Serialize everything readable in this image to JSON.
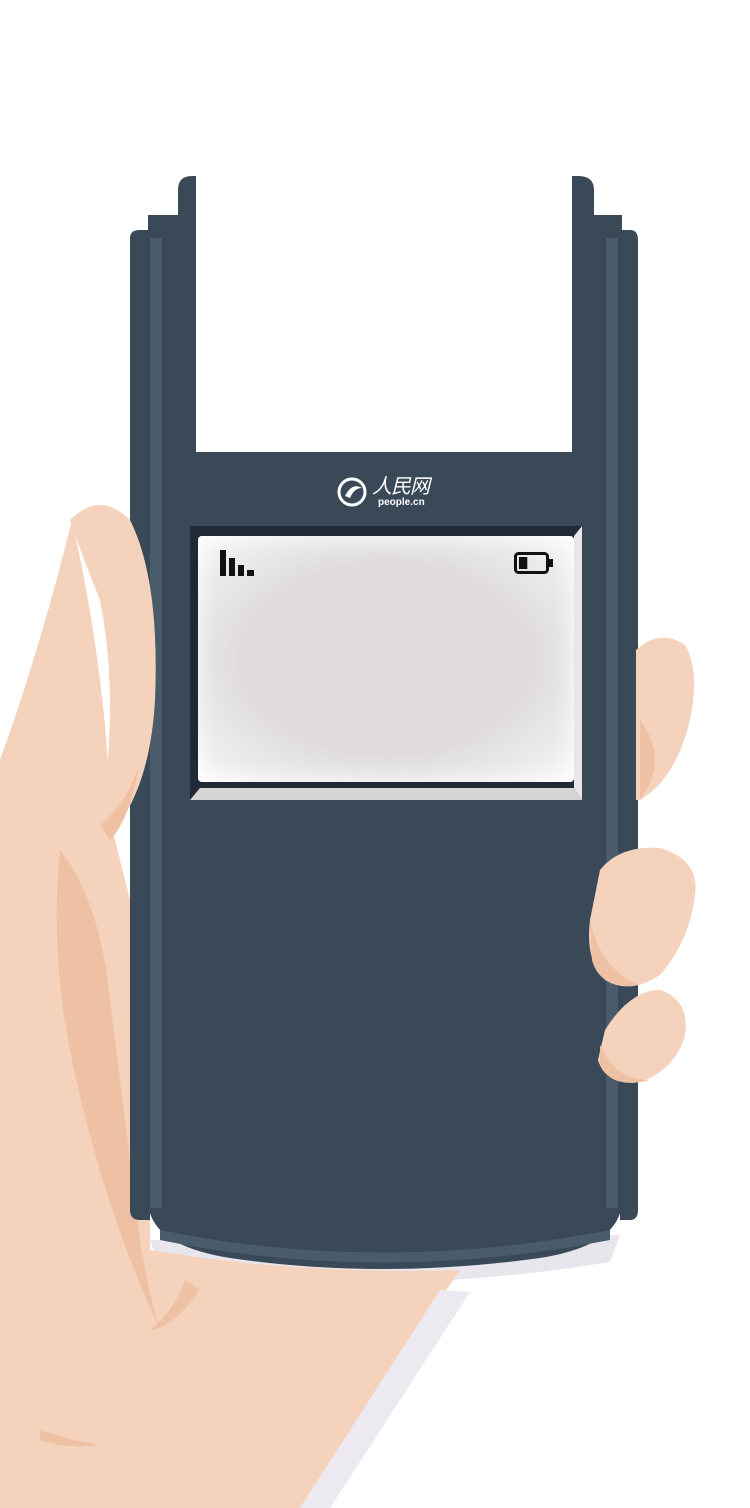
{
  "brand": {
    "logo_text_cn": "人民网",
    "logo_text_en": "people.cn"
  },
  "status_bar": {
    "signal_icon": "signal-bars-icon",
    "battery_icon": "battery-low-icon",
    "battery_level": 0.25
  },
  "colors": {
    "phone_body": "#394958",
    "phone_edge": "#4a5b6a",
    "screen_bezel": "#1f2a35",
    "skin": "#f5d2bb",
    "skin_shadow": "#efc1a4",
    "screen": "#e0dcdc"
  }
}
